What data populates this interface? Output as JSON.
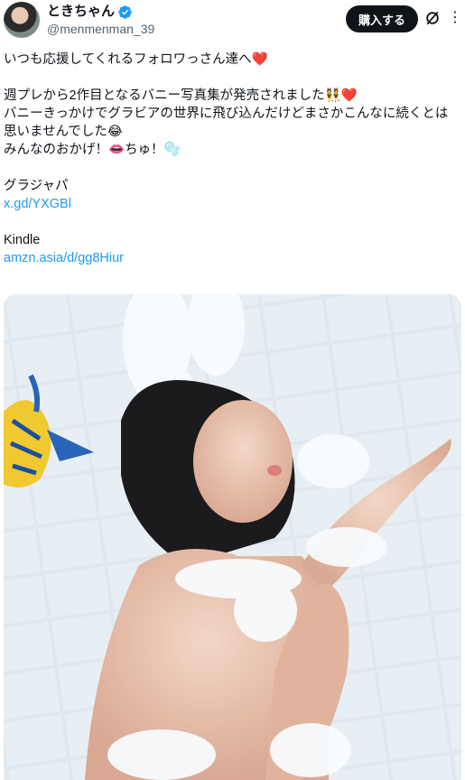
{
  "author": {
    "display_name": "ときちゃん",
    "handle": "@menmenman_39",
    "avatar_icon": "avatar-photo",
    "verified_icon": "verified-badge-icon",
    "verified_color": "#1d9bf0"
  },
  "header": {
    "buy_label": "購入する",
    "grok_icon": "grok-icon",
    "more_icon": "more-icon"
  },
  "tweet": {
    "line1": "いつも応援してくれるフォロワっさん達へ",
    "line1_emoji": "❤️",
    "line2": "週プレから2作目となるバニー写真集が発売されました",
    "line2_emoji": "👯❤️",
    "line3": "バニーきっかけでグラビアの世界に飛び込んだけどまさかこんなに続くとは思いませんでした",
    "line3_emoji": "😂",
    "line4": "みんなのおかげ！",
    "line4_emoji1": "👄",
    "line4_mid": "ちゅ！",
    "line4_emoji2": "🫧",
    "section1_title": "グラジャパ",
    "section1_link": "x.gd/YXGBl",
    "section2_title": "Kindle",
    "section2_link": "amzn.asia/d/gg8Hiur"
  },
  "colors": {
    "link": "#1d9bf0",
    "text": "#0f1419",
    "secondary": "#536471"
  }
}
